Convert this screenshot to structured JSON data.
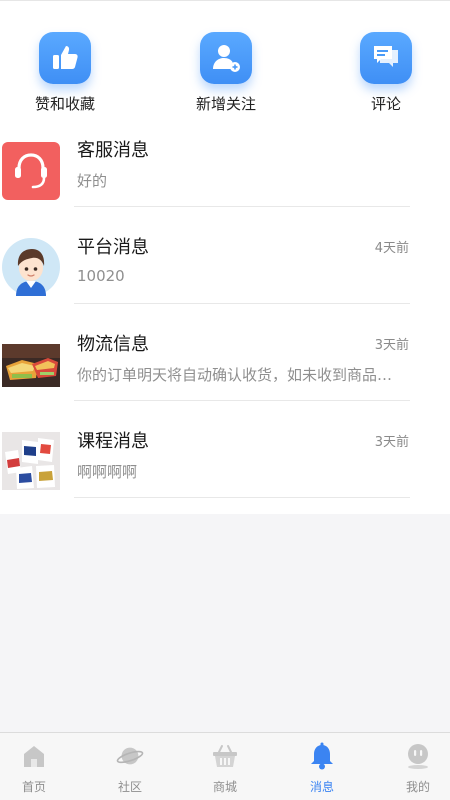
{
  "quick_actions": [
    {
      "label": "赞和收藏",
      "icon": "thumbs-up-icon"
    },
    {
      "label": "新增关注",
      "icon": "add-user-icon"
    },
    {
      "label": "评论",
      "icon": "comment-icon"
    }
  ],
  "messages": [
    {
      "title": "客服消息",
      "time": "",
      "preview": "好的",
      "avatar": "headset-avatar"
    },
    {
      "title": "平台消息",
      "time": "4天前",
      "preview": "10020",
      "avatar": "boy-avatar"
    },
    {
      "title": "物流信息",
      "time": "3天前",
      "preview": "你的订单明天将自动确认收货，如未收到商品请及时联系商家",
      "avatar": "food-photo-avatar"
    },
    {
      "title": "课程消息",
      "time": "3天前",
      "preview": "啊啊啊啊",
      "avatar": "gift-bags-photo-avatar"
    }
  ],
  "tabbar": {
    "items": [
      {
        "label": "首页",
        "icon": "home-icon",
        "active": false
      },
      {
        "label": "社区",
        "icon": "planet-icon",
        "active": false
      },
      {
        "label": "商城",
        "icon": "basket-icon",
        "active": false
      },
      {
        "label": "消息",
        "icon": "bell-icon",
        "active": true
      },
      {
        "label": "我的",
        "icon": "profile-icon",
        "active": false
      }
    ]
  },
  "colors": {
    "accent": "#3b84f2",
    "icon_blue": "#4a9bf8",
    "headset_red": "#f2605f",
    "inactive": "#8e8e8e"
  }
}
